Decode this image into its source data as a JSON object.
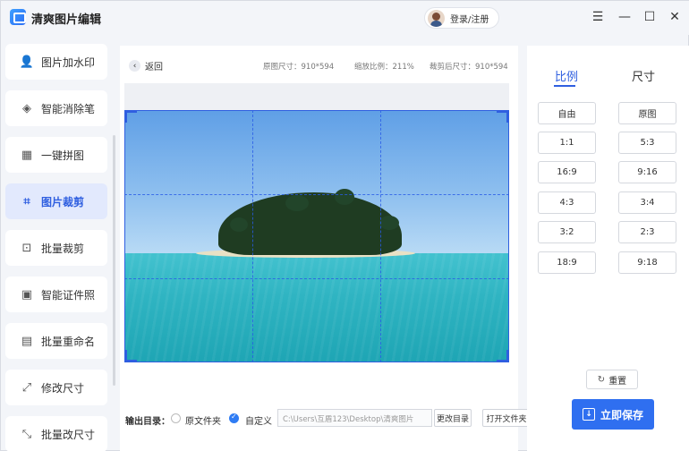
{
  "app": {
    "title": "清爽图片编辑",
    "login_label": "登录/注册",
    "window_controls": {
      "menu": "☰",
      "minimize": "—",
      "maximize": "☐",
      "close": "✕"
    }
  },
  "sidebar": {
    "items": [
      {
        "label": "图片加水印",
        "icon": "person-icon",
        "glyph": "👤"
      },
      {
        "label": "智能消除笔",
        "icon": "eraser-icon",
        "glyph": "◈"
      },
      {
        "label": "一键拼图",
        "icon": "collage-icon",
        "glyph": "▦"
      },
      {
        "label": "图片裁剪",
        "icon": "crop-icon",
        "glyph": "⌗"
      },
      {
        "label": "批量裁剪",
        "icon": "batch-crop-icon",
        "glyph": "⊡"
      },
      {
        "label": "智能证件照",
        "icon": "id-photo-icon",
        "glyph": "▣"
      },
      {
        "label": "批量重命名",
        "icon": "rename-icon",
        "glyph": "▤"
      },
      {
        "label": "修改尺寸",
        "icon": "resize-icon",
        "glyph": "⤢"
      },
      {
        "label": "批量改尺寸",
        "icon": "batch-resize-icon",
        "glyph": "⤡"
      }
    ],
    "active_index": 3
  },
  "main": {
    "back_label": "返回",
    "back_glyph": "‹",
    "original_size": "原图尺寸：910*594",
    "zoom_ratio": "缩放比例：211%",
    "cropped_size": "裁剪后尺寸：910*594"
  },
  "output": {
    "label": "输出目录：",
    "option_original": "原文件夹",
    "option_custom": "自定义",
    "selected": "custom",
    "path": "C:\\Users\\互盾123\\Desktop\\清爽图片",
    "change_dir_label": "更改目录",
    "open_folder_label": "打开文件夹"
  },
  "right_panel": {
    "tab_ratio": "比例",
    "tab_size": "尺寸",
    "active_tab": "ratio",
    "ratios_left": [
      "自由",
      "1:1",
      "16:9",
      "4:3",
      "3:2",
      "18:9"
    ],
    "ratios_right": [
      "原图",
      "5:3",
      "9:16",
      "3:4",
      "2:3",
      "9:18"
    ],
    "reset_label": "重置",
    "reset_glyph": "↻",
    "save_label": "立即保存",
    "save_glyph": "↓"
  },
  "colors": {
    "accent": "#2f6ff0",
    "active_bg": "#e2e9fd",
    "crop_line": "#2f5fe0"
  }
}
